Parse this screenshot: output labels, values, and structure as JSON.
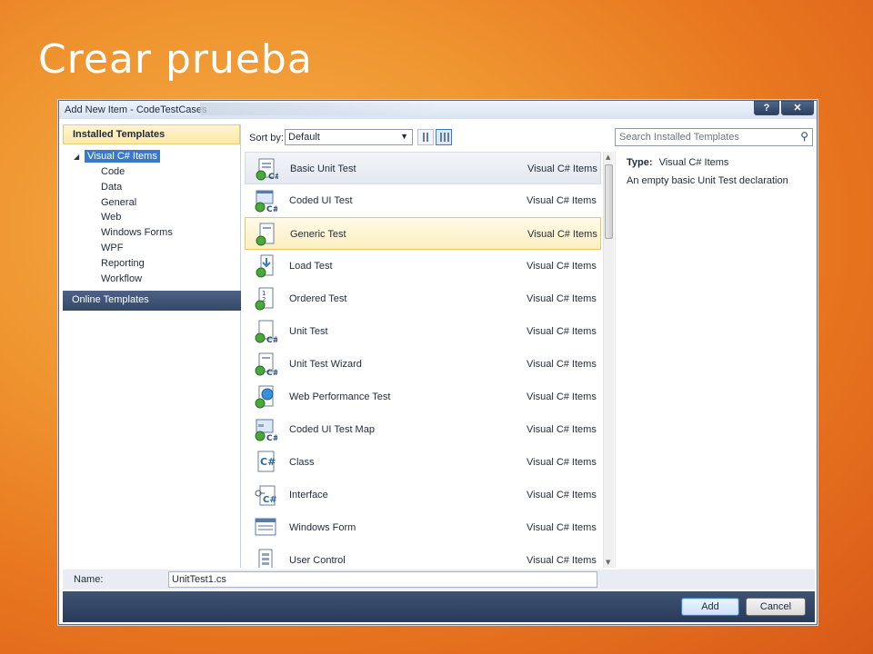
{
  "slide": {
    "title": "Crear prueba"
  },
  "dialog": {
    "title": "Add New Item - CodeTestCases",
    "help_label": "?",
    "close_label": "✕"
  },
  "left": {
    "header": "Installed Templates",
    "root": {
      "arrow": "◢",
      "label": "Visual C# Items"
    },
    "children": [
      "Code",
      "Data",
      "General",
      "Web",
      "Windows Forms",
      "WPF",
      "Reporting",
      "Workflow"
    ],
    "online": "Online Templates"
  },
  "sort": {
    "label": "Sort by:",
    "value": "Default",
    "caret": "▼"
  },
  "search": {
    "placeholder": "Search Installed Templates",
    "icon": "⚲"
  },
  "templates": [
    {
      "name": "Basic Unit Test",
      "category": "Visual C# Items",
      "icon": "test-icon"
    },
    {
      "name": "Coded UI Test",
      "category": "Visual C# Items",
      "icon": "coded-ui-icon"
    },
    {
      "name": "Generic Test",
      "category": "Visual C# Items",
      "icon": "generic-test-icon"
    },
    {
      "name": "Load Test",
      "category": "Visual C# Items",
      "icon": "load-test-icon"
    },
    {
      "name": "Ordered Test",
      "category": "Visual C# Items",
      "icon": "ordered-test-icon"
    },
    {
      "name": "Unit Test",
      "category": "Visual C# Items",
      "icon": "unit-test-icon"
    },
    {
      "name": "Unit Test Wizard",
      "category": "Visual C# Items",
      "icon": "wizard-icon"
    },
    {
      "name": "Web Performance Test",
      "category": "Visual C# Items",
      "icon": "web-test-icon"
    },
    {
      "name": "Coded UI Test Map",
      "category": "Visual C# Items",
      "icon": "ui-map-icon"
    },
    {
      "name": "Class",
      "category": "Visual C# Items",
      "icon": "class-icon"
    },
    {
      "name": "Interface",
      "category": "Visual C# Items",
      "icon": "interface-icon"
    },
    {
      "name": "Windows Form",
      "category": "Visual C# Items",
      "icon": "form-icon"
    },
    {
      "name": "User Control",
      "category": "Visual C# Items",
      "icon": "user-control-icon"
    }
  ],
  "scroll": {
    "up": "▲",
    "down": "▼"
  },
  "details": {
    "type_label": "Type:",
    "type_value": "Visual C# Items",
    "description": "An empty basic Unit Test declaration"
  },
  "name_field": {
    "label": "Name:",
    "value": "UnitTest1.cs"
  },
  "buttons": {
    "add": "Add",
    "cancel": "Cancel"
  }
}
